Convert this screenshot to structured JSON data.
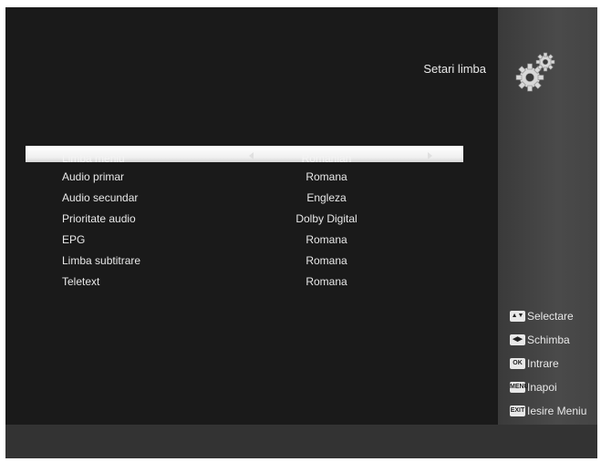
{
  "header": {
    "title": "Setari limba",
    "icon": "gears-icon"
  },
  "menu": {
    "items": [
      {
        "label": "Limba meniu",
        "value": "Romanian"
      },
      {
        "label": "Audio primar",
        "value": "Romana"
      },
      {
        "label": "Audio secundar",
        "value": "Engleza"
      },
      {
        "label": "Prioritate audio",
        "value": "Dolby Digital"
      },
      {
        "label": "EPG",
        "value": "Romana"
      },
      {
        "label": "Limba subtitrare",
        "value": "Romana"
      },
      {
        "label": "Teletext",
        "value": "Romana"
      }
    ]
  },
  "legend": {
    "items": [
      {
        "key_icon": "up-down-key-icon",
        "key_glyph": "▲▼",
        "label": "Selectare"
      },
      {
        "key_icon": "left-right-key-icon",
        "key_glyph": "◀▶",
        "label": "Schimba"
      },
      {
        "key_icon": "ok-key-icon",
        "key_glyph": "OK",
        "label": "Intrare"
      },
      {
        "key_icon": "menu-key-icon",
        "key_glyph": "MENU",
        "label": "Inapoi"
      },
      {
        "key_icon": "exit-key-icon",
        "key_glyph": "EXIT",
        "label": "Iesire Meniu"
      }
    ]
  },
  "colors": {
    "background": "#1a1a1a",
    "side_panel": "#444444",
    "highlight": "#ffffff",
    "text": "#e8e8e8"
  }
}
